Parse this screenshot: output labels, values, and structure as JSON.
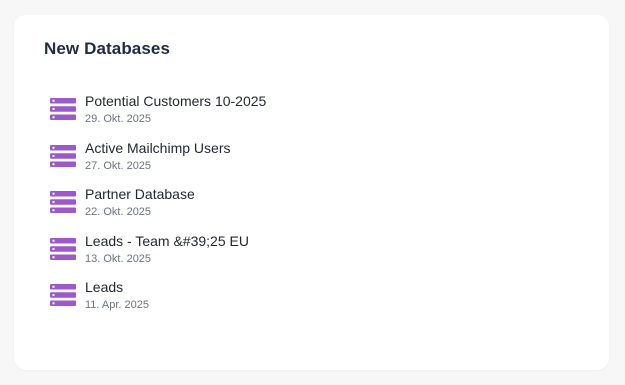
{
  "card": {
    "title": "New Databases"
  },
  "databases": [
    {
      "name": "Potential Customers 10-2025",
      "date": "29. Okt. 2025",
      "icon": "database-icon"
    },
    {
      "name": "Active Mailchimp Users",
      "date": "27. Okt. 2025",
      "icon": "database-icon"
    },
    {
      "name": "Partner Database",
      "date": "22. Okt. 2025",
      "icon": "database-icon"
    },
    {
      "name": "Leads - Team &#39;25 EU",
      "date": "13. Okt. 2025",
      "icon": "database-icon"
    },
    {
      "name": "Leads",
      "date": "11. Apr. 2025",
      "icon": "database-icon"
    }
  ],
  "colors": {
    "icon": "#9b59c9",
    "icon_dot": "#ffffff"
  }
}
